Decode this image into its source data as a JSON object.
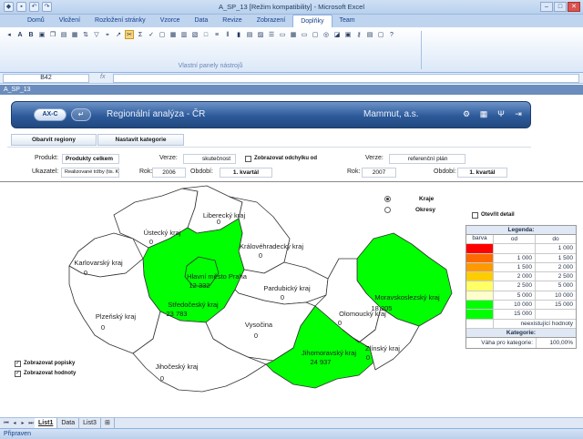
{
  "window": {
    "title": "A_SP_13  [Režim kompatibility]  -  Microsoft Excel"
  },
  "ribbon": {
    "tabs": [
      "Domů",
      "Vložení",
      "Rozložení stránky",
      "Vzorce",
      "Data",
      "Revize",
      "Zobrazení",
      "Doplňky",
      "Team"
    ],
    "active_tab": "Doplňky",
    "group_label": "Vlastní panely nástrojů"
  },
  "formula_bar": {
    "name_box": "B42",
    "fx_label": "fx"
  },
  "workbook": {
    "title": "A_SP_13"
  },
  "app": {
    "logo_label": "AX-C",
    "back_label": "↵",
    "title": "Regionální analýza - ČR",
    "company": "Mammut, a.s.",
    "icons": [
      "gear-icon",
      "table-icon",
      "wrench-icon",
      "exit-icon"
    ]
  },
  "nav": {
    "refresh_regions": "Obarvit regiony",
    "set_categories": "Nastavit kategorie"
  },
  "filters": {
    "produkt_label": "Produkt:",
    "produkt_value": "Produkty celkem",
    "verze1_label": "Verze:",
    "verze1_value": "skutečnost",
    "show_deviation_label": "Zobrazovat odchylku od",
    "verze2_label": "Verze:",
    "verze2_value": "referenční plán",
    "ukazatel_label": "Ukazatel:",
    "ukazatel_value": "Realizované tržby (tis. Kč)",
    "rok1_label": "Rok:",
    "rok1_value": "2006",
    "obdobi1_label": "Období:",
    "obdobi1_value": "1. kvartál",
    "rok2_label": "Rok:",
    "rok2_value": "2007",
    "obdobi2_label": "Období:",
    "obdobi2_value": "1. kvartál"
  },
  "options": {
    "kraje": "Kraje",
    "okresy": "Okresy",
    "selected": "Kraje",
    "open_detail": "Otevřít detail",
    "show_labels": "Zobrazovat popisky",
    "show_values": "Zobrazovat hodnoty"
  },
  "regions": [
    {
      "name": "Liberecký kraj",
      "value": "0",
      "color": "#ffffff"
    },
    {
      "name": "Ústecký kraj",
      "value": "0",
      "color": "#ffffff"
    },
    {
      "name": "Královéhradecký kraj",
      "value": "0",
      "color": "#ffffff"
    },
    {
      "name": "Karlovarský kraj",
      "value": "0",
      "color": "#ffffff"
    },
    {
      "name": "Hlavní město Praha",
      "value": "12 332",
      "color": "#00ff00"
    },
    {
      "name": "Středočeský kraj",
      "value": "23 783",
      "color": "#00ff00"
    },
    {
      "name": "Pardubický kraj",
      "value": "0",
      "color": "#ffffff"
    },
    {
      "name": "Moravskoslezský kraj",
      "value": "18 205",
      "color": "#00ff00"
    },
    {
      "name": "Plzeňský kraj",
      "value": "0",
      "color": "#ffffff"
    },
    {
      "name": "Olomoucký kraj",
      "value": "0",
      "color": "#ffffff"
    },
    {
      "name": "Vysočina",
      "value": "0",
      "color": "#ffffff"
    },
    {
      "name": "Jihomoravský kraj",
      "value": "24 937",
      "color": "#00ff00"
    },
    {
      "name": "Zlínský kraj",
      "value": "0",
      "color": "#ffffff"
    },
    {
      "name": "Jihočeský kraj",
      "value": "0",
      "color": "#ffffff"
    }
  ],
  "legend": {
    "title": "Legenda:",
    "col_color": "barva",
    "col_from": "od",
    "col_to": "do",
    "rows": [
      {
        "color": "#ff0000",
        "from": "",
        "to": "1 000"
      },
      {
        "color": "#ff6a00",
        "from": "1 000",
        "to": "1 500"
      },
      {
        "color": "#ff9900",
        "from": "1 500",
        "to": "2 000"
      },
      {
        "color": "#ffcc00",
        "from": "2 000",
        "to": "2 500"
      },
      {
        "color": "#ffff66",
        "from": "2 500",
        "to": "5 000"
      },
      {
        "color": "#ffffcc",
        "from": "5 000",
        "to": "10 000"
      },
      {
        "color": "#00ff00",
        "from": "10 000",
        "to": "15 000"
      },
      {
        "color": "#00ff00",
        "from": "15 000",
        "to": ""
      }
    ],
    "no_value": "neexistující hodnoty",
    "categories_title": "Kategorie:",
    "weight_label": "Váha pro kategorie:",
    "weight_value": "100,00%"
  },
  "sheets": {
    "tabs": [
      "List1",
      "Data",
      "List3"
    ],
    "active": "List1"
  },
  "status": {
    "text": "Připraven"
  }
}
